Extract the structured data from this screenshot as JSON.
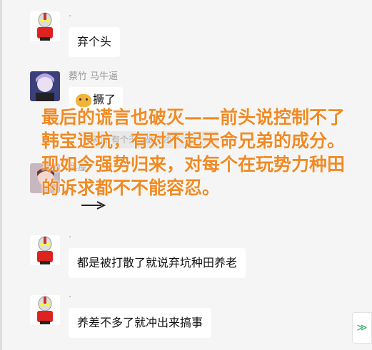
{
  "messages": [
    {
      "nick": "·",
      "text": "弃个头"
    },
    {
      "nick": "蔡竹 马牛逼",
      "text": "撅了"
    },
    {
      "nick": "黑屋",
      "text": ""
    },
    {
      "nick": "·",
      "text": "都是被打散了就说弃坑种田养老"
    },
    {
      "nick": "·",
      "text": "养差不多了就冲出来搞事"
    }
  ],
  "reply_quote": "吞天渡:有个天顶破天顶了",
  "overlay": {
    "line1": "最后的谎言也破灭——前头说控制不了韩宝退坑，有对不起天命兄弟的成分。",
    "line2": "现如今强势归来，对每个在玩势力种田的诉求都不不能容忍。"
  },
  "scroll_button": "≫",
  "colors": {
    "overlay": "#f08a24",
    "background": "#f5f5f5",
    "bubble": "#ffffff"
  }
}
